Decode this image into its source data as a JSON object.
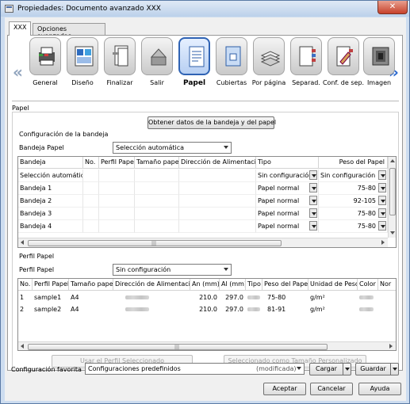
{
  "window": {
    "title": "Propiedades: Documento avanzado XXX",
    "close_label": "✕"
  },
  "tabs": [
    {
      "label": "XXX"
    },
    {
      "label": "Opciones avanzadas"
    }
  ],
  "toolbar": {
    "items": [
      {
        "label": "General",
        "icon": "printer-icon"
      },
      {
        "label": "Diseño",
        "icon": "layout-icon"
      },
      {
        "label": "Finalizar",
        "icon": "finishing-icon"
      },
      {
        "label": "Salir",
        "icon": "output-tray-icon"
      },
      {
        "label": "Papel",
        "icon": "paper-icon"
      },
      {
        "label": "Cubiertas",
        "icon": "cover-icon"
      },
      {
        "label": "Por página",
        "icon": "per-page-icon"
      },
      {
        "label": "Separad.",
        "icon": "separator-icon"
      },
      {
        "label": "Conf. de sep.",
        "icon": "separator-settings-icon"
      },
      {
        "label": "Imagen",
        "icon": "image-icon"
      }
    ],
    "active_index": 4
  },
  "paper": {
    "section_title": "Papel",
    "get_tray_button": "Obtener datos de la bandeja y del papel",
    "tray_config_title": "Configuración de la bandeja",
    "tray_paper_label": "Bandeja Papel",
    "tray_paper_value": "Selección automática",
    "tray_table": {
      "columns": [
        "Bandeja",
        "No.",
        "Perfil Papel",
        "Tamaño papel",
        "Dirección de Alimentación",
        "Tipo",
        "Peso del Papel"
      ],
      "rows": [
        {
          "bandeja": "Selección automática",
          "tipo": "Sin configuración",
          "peso": "Sin configuración"
        },
        {
          "bandeja": "Bandeja 1",
          "tipo": "Papel normal",
          "peso": "75-80"
        },
        {
          "bandeja": "Bandeja 2",
          "tipo": "Papel normal",
          "peso": "92-105"
        },
        {
          "bandeja": "Bandeja 3",
          "tipo": "Papel normal",
          "peso": "75-80"
        },
        {
          "bandeja": "Bandeja 4",
          "tipo": "Papel normal",
          "peso": "75-80"
        }
      ]
    },
    "profile_title": "Perfil Papel",
    "profile_label": "Perfil Papel",
    "profile_value": "Sin configuración",
    "profile_table": {
      "columns": [
        "No.",
        "Perfil Papel",
        "Tamaño papel",
        "Dirección de Alimentación",
        "An (mm)",
        "Al (mm)",
        "Tipo",
        "Peso del Papel",
        "Unidad de Peso",
        "Color",
        "Nor"
      ],
      "rows": [
        {
          "no": "1",
          "perfil": "sample1",
          "tamano": "A4",
          "an": "210.0",
          "al": "297.0",
          "peso": "75-80",
          "unidad": "g/m²"
        },
        {
          "no": "2",
          "perfil": "sample2",
          "tamano": "A4",
          "an": "210.0",
          "al": "297.0",
          "peso": "81-91",
          "unidad": "g/m²"
        }
      ]
    },
    "use_profile_button": "Usar el Perfil Seleccionado",
    "custom_size_button": "Seleccionado como Tamaño Personalizado"
  },
  "favorites": {
    "label": "Configuración favorita",
    "value": "Configuraciones predefinidos",
    "modified": "(modificada)",
    "load_button": "Cargar",
    "save_button": "Guardar"
  },
  "footer": {
    "ok": "Aceptar",
    "cancel": "Cancelar",
    "help": "Ayuda"
  }
}
